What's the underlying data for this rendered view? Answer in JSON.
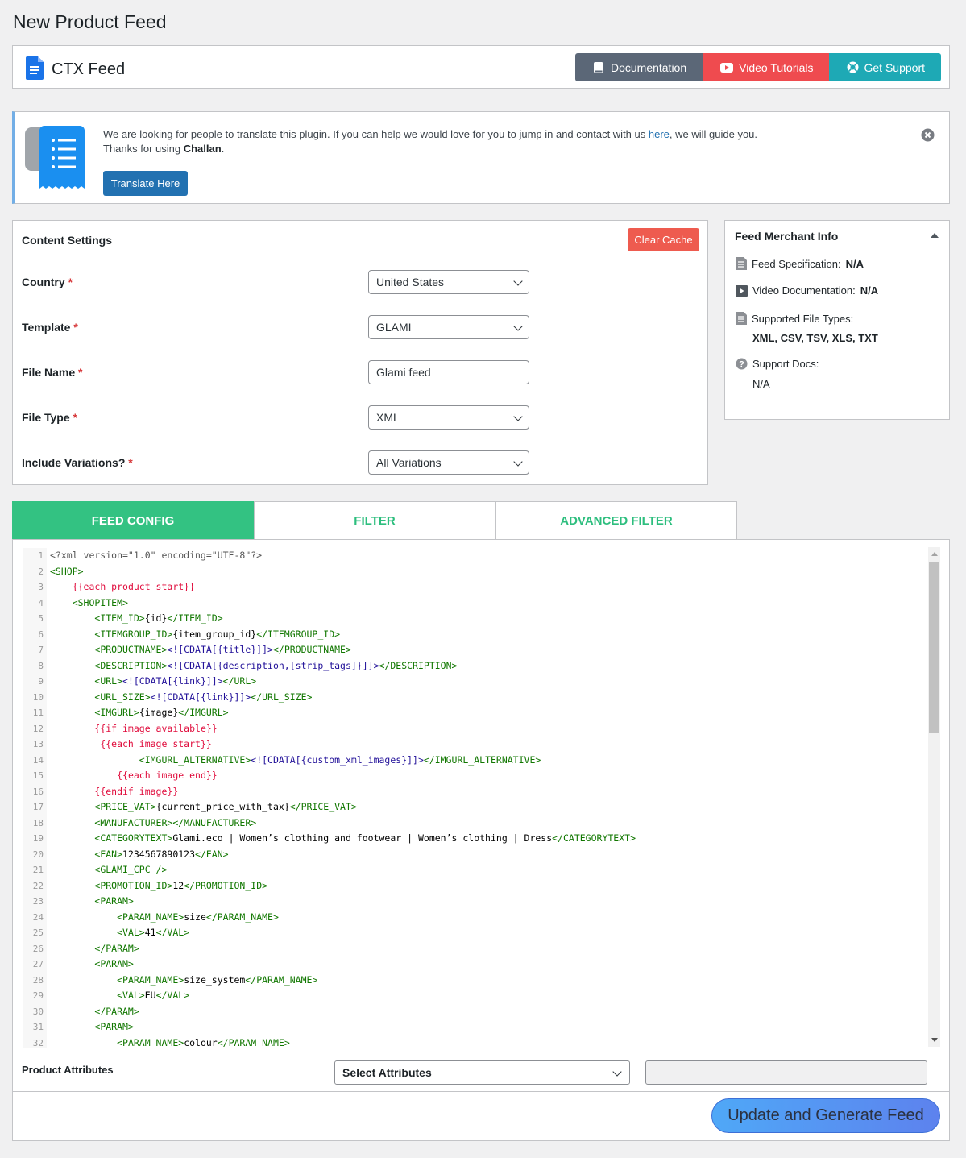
{
  "page": {
    "title": "New Product Feed"
  },
  "brand": {
    "name": "CTX Feed",
    "buttons": {
      "documentation": "Documentation",
      "video": "Video Tutorials",
      "support": "Get Support"
    }
  },
  "notice": {
    "text_before_link": "We are looking for people to translate this plugin. If you can help we would love for you to jump in and contact with us ",
    "link_text": "here",
    "text_after_link": ", we will guide you.",
    "thanks_prefix": "Thanks for using ",
    "thanks_name": "Challan",
    "thanks_suffix": ".",
    "button": "Translate Here"
  },
  "content_settings": {
    "title": "Content Settings",
    "clear_cache": "Clear Cache",
    "required_mark": "*",
    "fields": {
      "country": {
        "label": "Country",
        "value": "United States"
      },
      "template": {
        "label": "Template",
        "value": "GLAMI"
      },
      "file_name": {
        "label": "File Name",
        "value": "Glami feed"
      },
      "file_type": {
        "label": "File Type",
        "value": "XML"
      },
      "variations": {
        "label": "Include Variations?",
        "value": "All Variations"
      }
    }
  },
  "merchant": {
    "title": "Feed Merchant Info",
    "spec_label": "Feed Specification:",
    "spec_value": "N/A",
    "video_label": "Video Documentation:",
    "video_value": "N/A",
    "types_label": "Supported File Types:",
    "types_value": "XML, CSV, TSV, XLS, TXT",
    "docs_label": "Support Docs:",
    "docs_value": "N/A"
  },
  "tabs": {
    "feed_config": "FEED CONFIG",
    "filter": "FILTER",
    "advanced_filter": "ADVANCED FILTER"
  },
  "editor": {
    "lines": [
      {
        "n": "1",
        "segs": [
          [
            "meta",
            "<?xml version=\"1.0\" encoding=\"UTF-8\"?>"
          ]
        ]
      },
      {
        "n": "2",
        "segs": [
          [
            "t",
            "<SHOP>"
          ]
        ]
      },
      {
        "n": "3",
        "segs": [
          [
            "p",
            "    "
          ],
          [
            "h",
            "{{each product start}}"
          ]
        ]
      },
      {
        "n": "4",
        "segs": [
          [
            "p",
            "    "
          ],
          [
            "t",
            "<SHOPITEM>"
          ]
        ]
      },
      {
        "n": "5",
        "segs": [
          [
            "p",
            "        "
          ],
          [
            "t",
            "<ITEM_ID>"
          ],
          [
            "p",
            "{id}"
          ],
          [
            "t",
            "</ITEM_ID>"
          ]
        ]
      },
      {
        "n": "6",
        "segs": [
          [
            "p",
            "        "
          ],
          [
            "t",
            "<ITEMGROUP_ID>"
          ],
          [
            "p",
            "{item_group_id}"
          ],
          [
            "t",
            "</ITEMGROUP_ID>"
          ]
        ]
      },
      {
        "n": "7",
        "segs": [
          [
            "p",
            "        "
          ],
          [
            "t",
            "<PRODUCTNAME>"
          ],
          [
            "m",
            "<![CDATA[{title}]]>"
          ],
          [
            "t",
            "</PRODUCTNAME>"
          ]
        ]
      },
      {
        "n": "8",
        "segs": [
          [
            "p",
            "        "
          ],
          [
            "t",
            "<DESCRIPTION>"
          ],
          [
            "m",
            "<![CDATA[{description,[strip_tags]}]]>"
          ],
          [
            "t",
            "</DESCRIPTION>"
          ]
        ]
      },
      {
        "n": "9",
        "segs": [
          [
            "p",
            "        "
          ],
          [
            "t",
            "<URL>"
          ],
          [
            "m",
            "<![CDATA[{link}]]>"
          ],
          [
            "t",
            "</URL>"
          ]
        ]
      },
      {
        "n": "10",
        "segs": [
          [
            "p",
            "        "
          ],
          [
            "t",
            "<URL_SIZE>"
          ],
          [
            "m",
            "<![CDATA[{link}]]>"
          ],
          [
            "t",
            "</URL_SIZE>"
          ]
        ]
      },
      {
        "n": "11",
        "segs": [
          [
            "p",
            "        "
          ],
          [
            "t",
            "<IMGURL>"
          ],
          [
            "p",
            "{image}"
          ],
          [
            "t",
            "</IMGURL>"
          ]
        ]
      },
      {
        "n": "12",
        "segs": [
          [
            "p",
            "        "
          ],
          [
            "h",
            "{{if image available}}"
          ]
        ]
      },
      {
        "n": "13",
        "segs": [
          [
            "p",
            "         "
          ],
          [
            "h",
            "{{each image start}}"
          ]
        ]
      },
      {
        "n": "14",
        "segs": [
          [
            "p",
            "                "
          ],
          [
            "t",
            "<IMGURL_ALTERNATIVE>"
          ],
          [
            "m",
            "<![CDATA[{custom_xml_images}]]>"
          ],
          [
            "t",
            "</IMGURL_ALTERNATIVE>"
          ]
        ]
      },
      {
        "n": "15",
        "segs": [
          [
            "p",
            "            "
          ],
          [
            "h",
            "{{each image end}}"
          ]
        ]
      },
      {
        "n": "16",
        "segs": [
          [
            "p",
            "        "
          ],
          [
            "h",
            "{{endif image}}"
          ]
        ]
      },
      {
        "n": "17",
        "segs": [
          [
            "p",
            "        "
          ],
          [
            "t",
            "<PRICE_VAT>"
          ],
          [
            "p",
            "{current_price_with_tax}"
          ],
          [
            "t",
            "</PRICE_VAT>"
          ]
        ]
      },
      {
        "n": "18",
        "segs": [
          [
            "p",
            "        "
          ],
          [
            "t",
            "<MANUFACTURER></MANUFACTURER>"
          ]
        ]
      },
      {
        "n": "19",
        "segs": [
          [
            "p",
            "        "
          ],
          [
            "t",
            "<CATEGORYTEXT>"
          ],
          [
            "p",
            "Glami.eco | Women’s clothing and footwear | Women’s clothing | Dress"
          ],
          [
            "t",
            "</CATEGORYTEXT>"
          ]
        ]
      },
      {
        "n": "20",
        "segs": [
          [
            "p",
            "        "
          ],
          [
            "t",
            "<EAN>"
          ],
          [
            "p",
            "1234567890123"
          ],
          [
            "t",
            "</EAN>"
          ]
        ]
      },
      {
        "n": "21",
        "segs": [
          [
            "p",
            "        "
          ],
          [
            "t",
            "<GLAMI_CPC />"
          ]
        ]
      },
      {
        "n": "22",
        "segs": [
          [
            "p",
            "        "
          ],
          [
            "t",
            "<PROMOTION_ID>"
          ],
          [
            "p",
            "12"
          ],
          [
            "t",
            "</PROMOTION_ID>"
          ]
        ]
      },
      {
        "n": "23",
        "segs": [
          [
            "p",
            "        "
          ],
          [
            "t",
            "<PARAM>"
          ]
        ]
      },
      {
        "n": "24",
        "segs": [
          [
            "p",
            "            "
          ],
          [
            "t",
            "<PARAM_NAME>"
          ],
          [
            "p",
            "size"
          ],
          [
            "t",
            "</PARAM_NAME>"
          ]
        ]
      },
      {
        "n": "25",
        "segs": [
          [
            "p",
            "            "
          ],
          [
            "t",
            "<VAL>"
          ],
          [
            "p",
            "41"
          ],
          [
            "t",
            "</VAL>"
          ]
        ]
      },
      {
        "n": "26",
        "segs": [
          [
            "p",
            "        "
          ],
          [
            "t",
            "</PARAM>"
          ]
        ]
      },
      {
        "n": "27",
        "segs": [
          [
            "p",
            "        "
          ],
          [
            "t",
            "<PARAM>"
          ]
        ]
      },
      {
        "n": "28",
        "segs": [
          [
            "p",
            "            "
          ],
          [
            "t",
            "<PARAM_NAME>"
          ],
          [
            "p",
            "size_system"
          ],
          [
            "t",
            "</PARAM_NAME>"
          ]
        ]
      },
      {
        "n": "29",
        "segs": [
          [
            "p",
            "            "
          ],
          [
            "t",
            "<VAL>"
          ],
          [
            "p",
            "EU"
          ],
          [
            "t",
            "</VAL>"
          ]
        ]
      },
      {
        "n": "30",
        "segs": [
          [
            "p",
            "        "
          ],
          [
            "t",
            "</PARAM>"
          ]
        ]
      },
      {
        "n": "31",
        "segs": [
          [
            "p",
            "        "
          ],
          [
            "t",
            "<PARAM>"
          ]
        ]
      },
      {
        "n": "32",
        "segs": [
          [
            "p",
            "            "
          ],
          [
            "t",
            "<PARAM_NAME>"
          ],
          [
            "p",
            "colour"
          ],
          [
            "t",
            "</PARAM_NAME>"
          ]
        ]
      }
    ]
  },
  "attributes": {
    "label": "Product Attributes",
    "select_value": "Select Attributes",
    "input_value": ""
  },
  "generate_button": "Update and Generate Feed",
  "colors": {
    "documentation": "#5b6777",
    "video": "#ef4b4f",
    "support": "#1ea9b5",
    "tab_active": "#33c282",
    "clear_cache": "#ee5b4f",
    "primary_blue": "#2271b1"
  }
}
